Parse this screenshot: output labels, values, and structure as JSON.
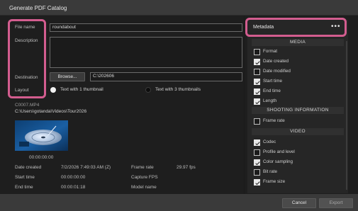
{
  "window": {
    "title": "Generate PDF Catalog"
  },
  "form": {
    "file_name_label": "File name",
    "file_name_value": "roundabout",
    "description_label": "Description",
    "destination_label": "Destination",
    "browse_label": "Browse...",
    "destination_value": "C:\\202606",
    "layout_label": "Layout",
    "layout_options": [
      "Text with 1 thumbnail",
      "Text with 3 thumbnails"
    ]
  },
  "clip": {
    "name": "C0007.MP4",
    "path": "C:\\Users\\gotanda\\Videos\\Tour2026",
    "thumb_timecode": "00:00:00:00",
    "info": [
      {
        "label": "Date created",
        "value": "7/2/2026 7:49:03 AM (Z)",
        "label2": "Frame rate",
        "value2": "29.97 fps"
      },
      {
        "label": "Start time",
        "value": "00:00:00:00",
        "label2": "Capture FPS",
        "value2": ""
      },
      {
        "label": "End time",
        "value": "00:00:01:18",
        "label2": "Model name",
        "value2": ""
      }
    ]
  },
  "metadata": {
    "title": "Metadata",
    "more_icon": "more-icon",
    "sections": [
      {
        "title": "MEDIA",
        "items": [
          {
            "label": "Format",
            "checked": false
          },
          {
            "label": "Date created",
            "checked": true
          },
          {
            "label": "Date modified",
            "checked": false
          },
          {
            "label": "Start time",
            "checked": true
          },
          {
            "label": "End time",
            "checked": true
          },
          {
            "label": "Length",
            "checked": true
          }
        ]
      },
      {
        "title": "SHOOTING INFORMATION",
        "items": [
          {
            "label": "Frame rate",
            "checked": false
          }
        ]
      },
      {
        "title": "VIDEO",
        "items": [
          {
            "label": "Codec",
            "checked": true
          },
          {
            "label": "Profile and level",
            "checked": false
          },
          {
            "label": "Color sampling",
            "checked": true
          },
          {
            "label": "Bit rate",
            "checked": false
          },
          {
            "label": "Frame size",
            "checked": true
          }
        ]
      }
    ]
  },
  "footer": {
    "cancel_label": "Cancel",
    "export_label": "Export"
  },
  "colors": {
    "highlight": "#d35d8f",
    "background": "#1e1e1e"
  }
}
